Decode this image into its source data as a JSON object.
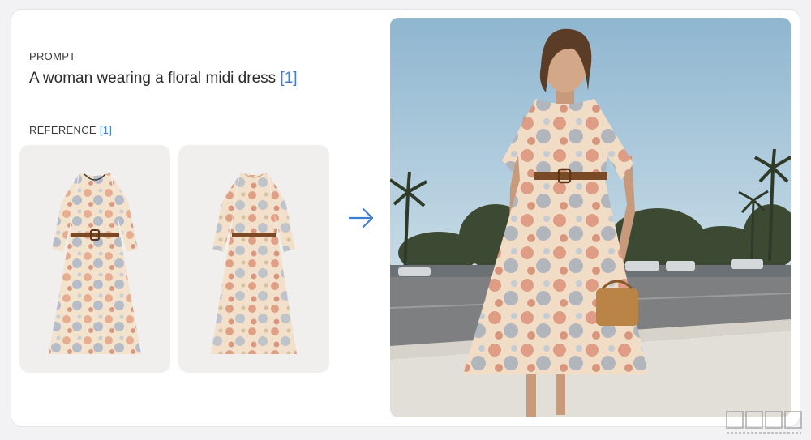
{
  "prompt": {
    "label": "PROMPT",
    "text": "A woman wearing a floral midi dress",
    "citation": "[1]"
  },
  "reference": {
    "label": "REFERENCE",
    "citation": "[1]",
    "images": [
      "reference-dress-front",
      "reference-dress-back"
    ]
  },
  "arrow": {
    "icon": "arrow-right-icon",
    "color": "#3f7fd0"
  },
  "result": {
    "image": "generated-model-photo"
  },
  "colors": {
    "accent": "#3f7fd0",
    "sky": "#a8c8dd",
    "dress_base": "#f3e2cc",
    "floral_coral": "#d9826a",
    "floral_blue": "#7b93b4",
    "belt": "#7a4a26"
  },
  "watermark": {
    "icon": "watermark-logo"
  }
}
